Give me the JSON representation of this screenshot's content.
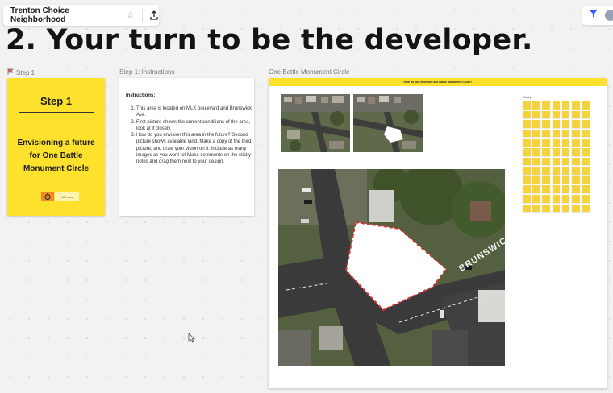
{
  "app": {
    "board_name": "Trenton Choice Neighborhood",
    "star_icon": "star-icon",
    "share_icon": "upload-icon"
  },
  "heading": "2. Your turn to be the developer.",
  "frames": {
    "step1_label": "Step 1",
    "instructions_label": "Step 1: Instructions",
    "board_label": "One Battle Monument Circle"
  },
  "step_card": {
    "title": "Step 1",
    "description": "Envisioning a future for One Battle Monument Circle",
    "timer_label": "10 mins",
    "timer_color": "#f08a24",
    "card_color": "#fde12d"
  },
  "instructions": {
    "title": "Instructions:",
    "items": [
      "This area is located on MLK boulevard and Brunswick Ave.",
      "First picture shows the current conditions of the area, look at it closely.",
      "How do you envision this area in the future? Second picture shows available land. Make a copy of the third picture, and draw your vision on it. Include as many images as you want to! Make comments on the sticky notes and drag them next to your design."
    ]
  },
  "board": {
    "header_text": "How do you envision One Battle Monument Circle?",
    "sticky_label": "Sticky",
    "sticky_color": "#f5d33f",
    "map_street_label": "BRUNSWICK"
  }
}
